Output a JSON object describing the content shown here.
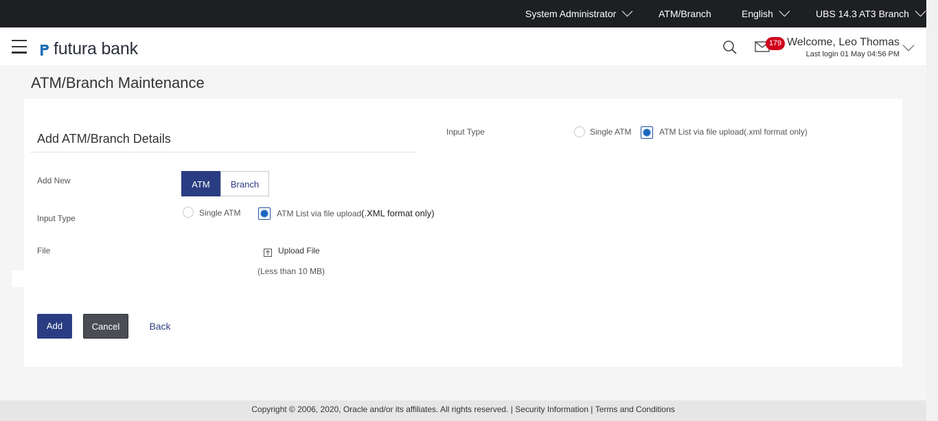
{
  "topbar": {
    "role": "System Administrator",
    "atm_branch": "ATM/Branch",
    "language": "English",
    "entity": "UBS 14.3 AT3 Branch"
  },
  "header": {
    "logo_text": "futura bank",
    "notification_count": "179",
    "welcome": "Welcome, Leo Thomas",
    "last_login": "Last login 01 May 04:56 PM"
  },
  "page": {
    "title": "ATM/Branch Maintenance"
  },
  "form": {
    "section_title": "Add ATM/Branch Details",
    "add_new_label": "Add New",
    "seg_atm": "ATM",
    "seg_branch": "Branch",
    "input_type_label": "Input Type",
    "opt_single": "Single ATM",
    "opt_list_prefix": "ATM List via file upload",
    "opt_list_suffix": "(.XML format only)",
    "file_label": "File",
    "upload_label": "Upload File",
    "size_note": "(Less than 10 MB)",
    "right_input_type_label": "Input Type",
    "right_opt_single": "Single ATM",
    "right_opt_list": "ATM List via file upload(.xml format only)"
  },
  "actions": {
    "add": "Add",
    "cancel": "Cancel",
    "back": "Back"
  },
  "footer": {
    "copyright": "Copyright © 2006, 2020, Oracle and/or its affiliates. All rights reserved.",
    "sep1": " | ",
    "security": "Security Information",
    "sep2": " | ",
    "terms": "Terms and Conditions"
  },
  "colors": {
    "primary": "#2b3d82",
    "topbar": "#1d1f22",
    "badge": "#d0021b"
  }
}
